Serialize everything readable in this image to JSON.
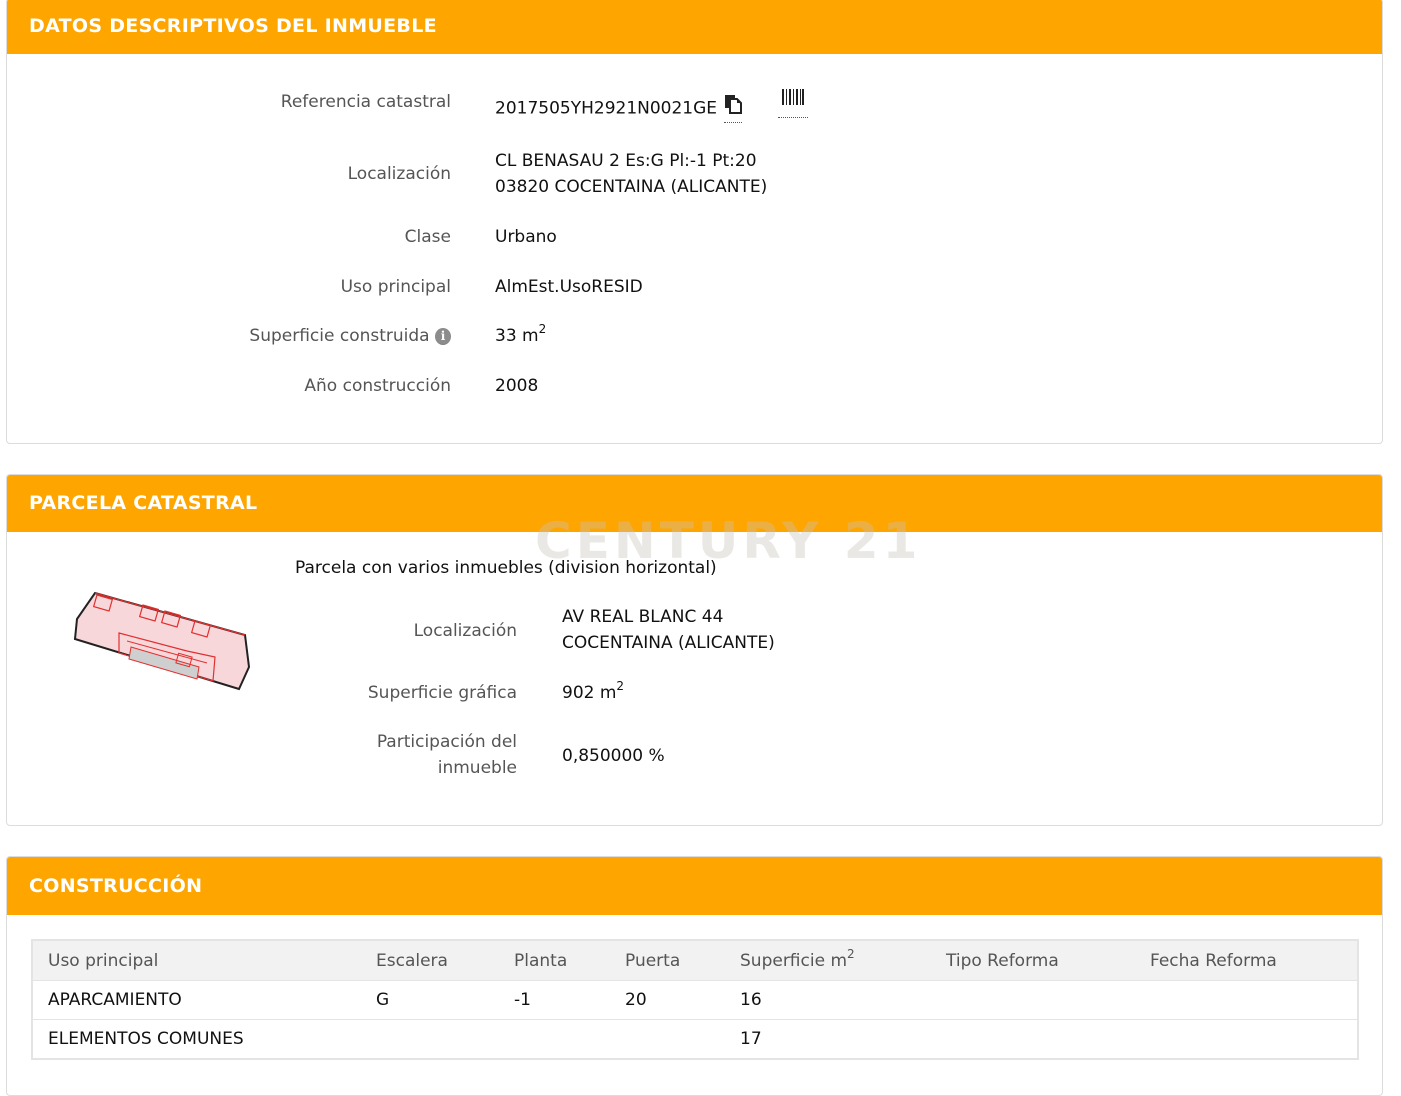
{
  "datos": {
    "title": "DATOS DESCRIPTIVOS DEL INMUEBLE",
    "ref_label": "Referencia catastral",
    "ref_value": "2017505YH2921N0021GE",
    "loc_label": "Localización",
    "loc_line1": "CL BENASAU 2 Es:G Pl:-1 Pt:20",
    "loc_line2": "03820 COCENTAINA (ALICANTE)",
    "clase_label": "Clase",
    "clase_value": "Urbano",
    "uso_label": "Uso principal",
    "uso_value": "AlmEst.UsoRESID",
    "sup_label": "Superficie construida",
    "sup_value": "33 m",
    "sup_unit_exp": "2",
    "anio_label": "Año construcción",
    "anio_value": "2008"
  },
  "parcela": {
    "title": "PARCELA CATASTRAL",
    "watermark": "CENTURY 21",
    "note": "Parcela con varios inmuebles (division horizontal)",
    "loc_label": "Localización",
    "loc_line1": "AV REAL BLANC 44",
    "loc_line2": "COCENTAINA (ALICANTE)",
    "sup_label": "Superficie gráfica",
    "sup_value": "902 m",
    "sup_unit_exp": "2",
    "part_label_line1": "Participación del",
    "part_label_line2": "inmueble",
    "part_value": "0,850000 %"
  },
  "construccion": {
    "title": "CONSTRUCCIÓN",
    "headers": {
      "uso": "Uso principal",
      "escalera": "Escalera",
      "planta": "Planta",
      "puerta": "Puerta",
      "superficie": "Superficie m",
      "superficie_exp": "2",
      "tipo_reforma": "Tipo Reforma",
      "fecha_reforma": "Fecha Reforma"
    },
    "rows": [
      {
        "uso": "APARCAMIENTO",
        "escalera": "G",
        "planta": "-1",
        "puerta": "20",
        "superficie": "16",
        "tipo_reforma": "",
        "fecha_reforma": ""
      },
      {
        "uso": "ELEMENTOS COMUNES",
        "escalera": "",
        "planta": "",
        "puerta": "",
        "superficie": "17",
        "tipo_reforma": "",
        "fecha_reforma": ""
      }
    ]
  },
  "colors": {
    "header_bg": "#ffa500",
    "label_text": "#555555",
    "border": "#dcdcdc"
  },
  "icons": [
    "copy-icon",
    "barcode-icon",
    "info-icon",
    "parcel-map-thumbnail"
  ]
}
